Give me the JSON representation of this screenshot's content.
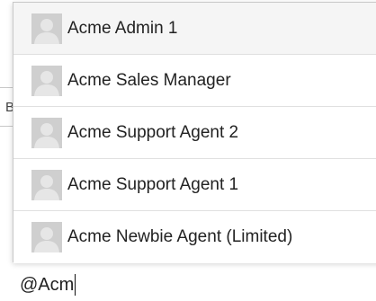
{
  "mention_suggestions": [
    {
      "name": "Acme Admin 1",
      "avatar_icon": "default-user-avatar-icon",
      "highlighted": true
    },
    {
      "name": "Acme Sales Manager",
      "avatar_icon": "default-user-avatar-icon",
      "highlighted": false
    },
    {
      "name": "Acme Support Agent 2",
      "avatar_icon": "default-user-avatar-icon",
      "highlighted": false
    },
    {
      "name": "Acme Support Agent 1",
      "avatar_icon": "default-user-avatar-icon",
      "highlighted": false
    },
    {
      "name": "Acme Newbie Agent (Limited)",
      "avatar_icon": "default-user-avatar-icon",
      "highlighted": false
    }
  ],
  "composer": {
    "text": "@Acm"
  },
  "colors": {
    "avatar_background": "#cfcfcf",
    "avatar_silhouette": "#e6e6e6",
    "highlight_row": "#f5f5f5",
    "border": "#c9c9c9"
  }
}
